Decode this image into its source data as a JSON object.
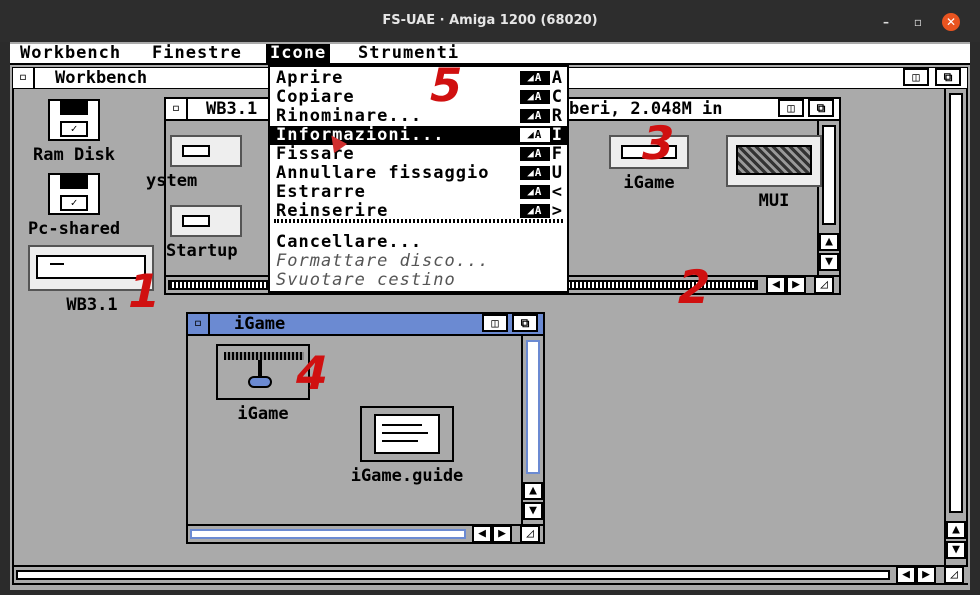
{
  "host": {
    "title": "FS-UAE · Amiga 1200 (68020)",
    "minimize_label": "–",
    "maximize_label": "▫",
    "close_label": "✕"
  },
  "menubar": {
    "items": [
      "Workbench",
      "Finestre",
      "Icone",
      "Strumenti"
    ],
    "active": "Icone"
  },
  "workbench_window": {
    "title": "Workbench"
  },
  "desktop_icons": [
    {
      "label": "Ram Disk",
      "type": "disk"
    },
    {
      "label": "Pc-shared",
      "type": "disk"
    },
    {
      "label": "WB3.1",
      "type": "drive"
    }
  ],
  "wb31_window": {
    "title_left": "WB3.1",
    "title_right": "beri, 2.048M in",
    "icons": [
      {
        "label": "ystem"
      },
      {
        "label": "Startup"
      },
      {
        "label": "iGame"
      },
      {
        "label": "MUI"
      }
    ]
  },
  "igame_window": {
    "title": "iGame",
    "icons": [
      {
        "label": "iGame"
      },
      {
        "label": "iGame.guide"
      }
    ]
  },
  "dropdown": {
    "items": [
      {
        "label": "Aprire",
        "key": "A",
        "state": "normal"
      },
      {
        "label": "Copiare",
        "key": "C",
        "state": "normal"
      },
      {
        "label": "Rinominare...",
        "key": "R",
        "state": "normal"
      },
      {
        "label": "Informazioni...",
        "key": "I",
        "state": "selected"
      },
      {
        "label": "Fissare",
        "key": "F",
        "state": "normal"
      },
      {
        "label": "Annullare fissaggio",
        "key": "U",
        "state": "normal"
      },
      {
        "label": "Estrarre",
        "key": "<",
        "state": "normal"
      },
      {
        "label": "Reinserire",
        "key": ">",
        "state": "normal"
      },
      {
        "label": "Cancellare...",
        "key": "",
        "state": "normal"
      },
      {
        "label": "Formattare disco...",
        "key": "",
        "state": "disabled"
      },
      {
        "label": "Svuotare cestino",
        "key": "",
        "state": "disabled"
      }
    ]
  },
  "annotations": [
    "1",
    "2",
    "3",
    "4",
    "5"
  ],
  "colors": {
    "amiga_grey": "#aaaaaa",
    "title_blue": "#6b8ad2",
    "annotation_red": "#d01010",
    "host_close": "#e95420"
  }
}
